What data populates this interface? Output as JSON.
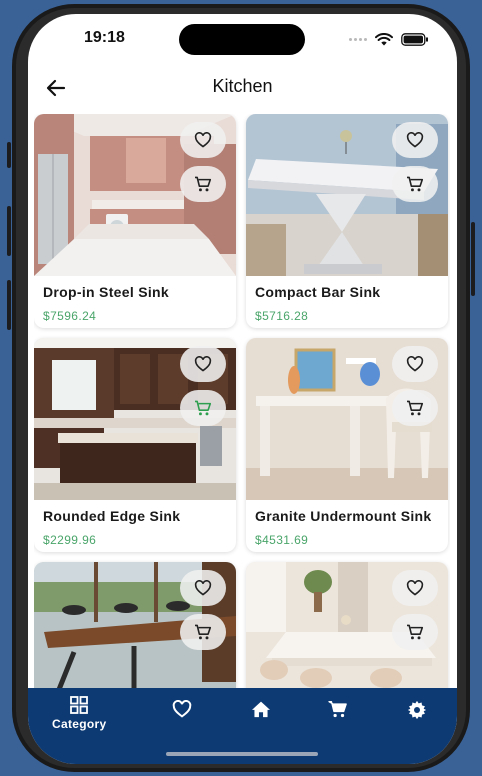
{
  "status_bar": {
    "time": "19:18"
  },
  "header": {
    "title": "Kitchen",
    "back_icon": "arrow-left-icon"
  },
  "products": [
    {
      "name": "Drop-in Steel Sink",
      "price": "$7596.24",
      "cart_color": "#222222"
    },
    {
      "name": "Compact Bar Sink",
      "price": "$5716.28",
      "cart_color": "#222222"
    },
    {
      "name": "Rounded Edge Sink",
      "price": "$2299.96",
      "cart_color": "#2e9e4f"
    },
    {
      "name": "Granite Undermount Sink",
      "price": "$4531.69",
      "cart_color": "#222222"
    },
    {
      "name": "",
      "price": "",
      "cart_color": "#222222"
    },
    {
      "name": "",
      "price": "",
      "cart_color": "#222222"
    }
  ],
  "bottom_nav": {
    "items": [
      {
        "label": "Category",
        "icon": "grid-icon"
      },
      {
        "label": "",
        "icon": "heart-icon"
      },
      {
        "label": "",
        "icon": "home-icon"
      },
      {
        "label": "",
        "icon": "cart-icon"
      },
      {
        "label": "",
        "icon": "gear-icon"
      }
    ]
  },
  "colors": {
    "nav_bg": "#0d3a73",
    "price": "#4aa56a",
    "accent_cart": "#2e9e4f"
  }
}
